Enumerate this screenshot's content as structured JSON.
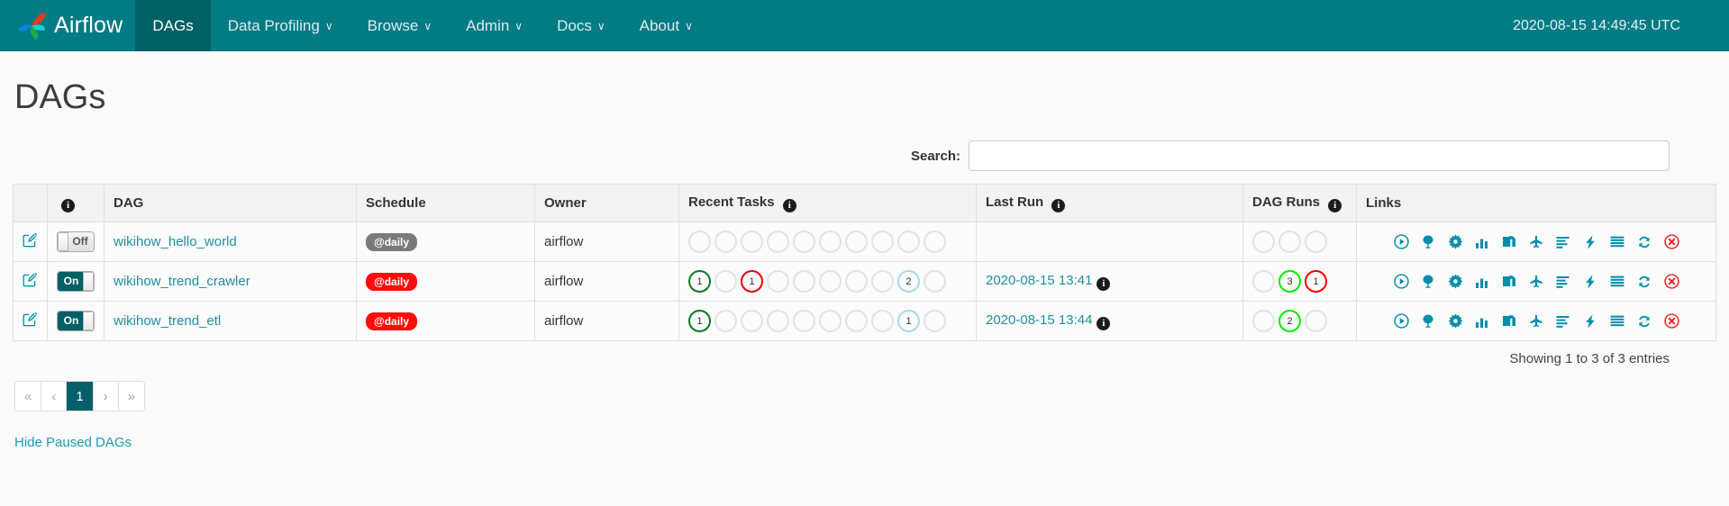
{
  "navbar": {
    "brand": "Airflow",
    "brand_logo_icon": "airflow-pinwheel-logo",
    "items": [
      {
        "label": "DAGs",
        "caret": "",
        "active": true
      },
      {
        "label": "Data Profiling",
        "caret": "∨",
        "active": false
      },
      {
        "label": "Browse",
        "caret": "∨",
        "active": false
      },
      {
        "label": "Admin",
        "caret": "∨",
        "active": false
      },
      {
        "label": "Docs",
        "caret": "∨",
        "active": false
      },
      {
        "label": "About",
        "caret": "∨",
        "active": false
      }
    ],
    "clock": "2020-08-15 14:49:45 UTC"
  },
  "page": {
    "title": "DAGs"
  },
  "search": {
    "label": "Search:",
    "value": "",
    "placeholder": ""
  },
  "table": {
    "headers": {
      "edit": "",
      "info": "ℹ",
      "dag": "DAG",
      "schedule": "Schedule",
      "owner": "Owner",
      "recent_tasks": "Recent Tasks",
      "last_run": "Last Run",
      "dag_runs": "DAG Runs",
      "links": "Links"
    },
    "rows": [
      {
        "edit_icon": "edit-pencil-icon",
        "toggle": {
          "state": "off",
          "label": "Off"
        },
        "dag": "wikihow_hello_world",
        "schedule": {
          "label": "@daily",
          "color": "gray"
        },
        "owner": "airflow",
        "recent_tasks": [
          {
            "count": "",
            "color": "empty"
          },
          {
            "count": "",
            "color": "empty"
          },
          {
            "count": "",
            "color": "empty"
          },
          {
            "count": "",
            "color": "empty"
          },
          {
            "count": "",
            "color": "empty"
          },
          {
            "count": "",
            "color": "empty"
          },
          {
            "count": "",
            "color": "empty"
          },
          {
            "count": "",
            "color": "empty"
          },
          {
            "count": "",
            "color": "empty"
          },
          {
            "count": "",
            "color": "empty"
          }
        ],
        "last_run": "",
        "dag_runs": [
          {
            "count": "",
            "color": "empty"
          },
          {
            "count": "",
            "color": "empty"
          },
          {
            "count": "",
            "color": "empty"
          }
        ]
      },
      {
        "edit_icon": "edit-pencil-icon",
        "toggle": {
          "state": "on",
          "label": "On"
        },
        "dag": "wikihow_trend_crawler",
        "schedule": {
          "label": "@daily",
          "color": "red"
        },
        "owner": "airflow",
        "recent_tasks": [
          {
            "count": "1",
            "color": "#0b7a24"
          },
          {
            "count": "",
            "color": "empty"
          },
          {
            "count": "1",
            "color": "#f00000"
          },
          {
            "count": "",
            "color": "empty"
          },
          {
            "count": "",
            "color": "empty"
          },
          {
            "count": "",
            "color": "empty"
          },
          {
            "count": "",
            "color": "empty"
          },
          {
            "count": "",
            "color": "empty"
          },
          {
            "count": "2",
            "color": "#a5d9ed"
          },
          {
            "count": "",
            "color": "empty"
          }
        ],
        "last_run": "2020-08-15 13:41",
        "dag_runs": [
          {
            "count": "",
            "color": "empty"
          },
          {
            "count": "3",
            "color": "#00ee00"
          },
          {
            "count": "1",
            "color": "#f00000"
          }
        ]
      },
      {
        "edit_icon": "edit-pencil-icon",
        "toggle": {
          "state": "on",
          "label": "On"
        },
        "dag": "wikihow_trend_etl",
        "schedule": {
          "label": "@daily",
          "color": "red"
        },
        "owner": "airflow",
        "recent_tasks": [
          {
            "count": "1",
            "color": "#0b7a24"
          },
          {
            "count": "",
            "color": "empty"
          },
          {
            "count": "",
            "color": "empty"
          },
          {
            "count": "",
            "color": "empty"
          },
          {
            "count": "",
            "color": "empty"
          },
          {
            "count": "",
            "color": "empty"
          },
          {
            "count": "",
            "color": "empty"
          },
          {
            "count": "",
            "color": "empty"
          },
          {
            "count": "1",
            "color": "#a5d9ed"
          },
          {
            "count": "",
            "color": "empty"
          }
        ],
        "last_run": "2020-08-15 13:44",
        "dag_runs": [
          {
            "count": "",
            "color": "empty"
          },
          {
            "count": "2",
            "color": "#00ee00"
          },
          {
            "count": "",
            "color": "empty"
          }
        ]
      }
    ],
    "link_icons": [
      "trigger-dag-icon",
      "tree-view-icon",
      "graph-view-icon",
      "task-duration-icon",
      "task-tries-icon",
      "landing-times-icon",
      "gantt-icon",
      "code-icon",
      "logs-icon",
      "refresh-icon",
      "delete-icon"
    ]
  },
  "footer": {
    "showing": "Showing 1 to 3 of 3 entries",
    "pagination": [
      {
        "label": "«",
        "active": false
      },
      {
        "label": "‹",
        "active": false
      },
      {
        "label": "1",
        "active": true
      },
      {
        "label": "›",
        "active": false
      },
      {
        "label": "»",
        "active": false
      }
    ],
    "hide_paused": "Hide Paused DAGs"
  },
  "colors": {
    "brand_teal": "#017b84",
    "active_nav": "#015f66",
    "link": "#1f8fa0",
    "badge_red": "#fb0d0d",
    "badge_gray": "#7a7a7a",
    "success_green": "#00ee00",
    "failed_red": "#f00000",
    "running_blue": "#a5d9ed"
  }
}
